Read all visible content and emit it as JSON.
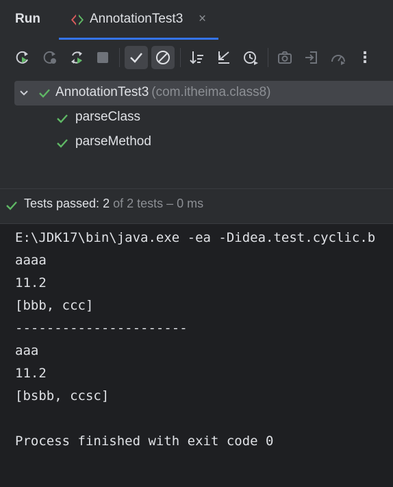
{
  "header": {
    "title": "Run",
    "tab": {
      "label": "AnnotationTest3",
      "close": "×"
    }
  },
  "toolbar": {
    "buttons": [
      "rerun-icon",
      "rerun-failed-icon",
      "toggle-auto-test-icon",
      "stop-icon",
      "show-passed-icon",
      "show-ignored-icon",
      "sort-icon",
      "collapse-icon",
      "history-icon",
      "screenshot-icon",
      "export-icon",
      "dashboard-icon",
      "more-icon"
    ],
    "more": "⋮"
  },
  "tree": {
    "root": {
      "name": "AnnotationTest3",
      "package": "(com.itheima.class8)"
    },
    "children": [
      "parseClass",
      "parseMethod"
    ]
  },
  "status": {
    "prefix": "Tests passed: ",
    "count": "2",
    "suffix": " of 2 tests – 0 ms"
  },
  "console": {
    "lines": [
      "E:\\JDK17\\bin\\java.exe -ea -Didea.test.cyclic.b",
      "aaaa",
      "11.2",
      "[bbb, ccc]",
      "----------------------",
      "aaa",
      "11.2",
      "[bsbb, ccsc]",
      "",
      "Process finished with exit code 0"
    ]
  },
  "colors": {
    "success": "#5fb865",
    "accent": "#3574f0",
    "panel": "#2b2d30",
    "console_bg": "#1e1f22"
  }
}
